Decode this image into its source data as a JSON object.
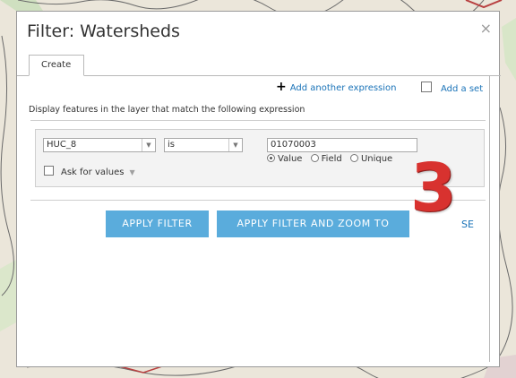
{
  "dialog": {
    "title": "Filter: Watersheds",
    "close_glyph": "×"
  },
  "tabs": [
    {
      "label": "Create",
      "active": true
    }
  ],
  "toolbar": {
    "add_expression_icon": "+",
    "add_expression_label": "Add another expression",
    "add_set_label": "Add a set"
  },
  "description": "Display features in the layer that match the following expression",
  "expression": {
    "field_value": "HUC_8",
    "operator_value": "is",
    "input_value": "01070003",
    "radio_options": [
      {
        "label": "Value",
        "selected": true
      },
      {
        "label": "Field",
        "selected": false
      },
      {
        "label": "Unique",
        "selected": false
      }
    ],
    "ask_for_values_label": "Ask for values",
    "ask_for_values_checked": false
  },
  "buttons": {
    "apply_filter": "APPLY FILTER",
    "apply_filter_zoom": "APPLY FILTER AND ZOOM TO",
    "close_partial": "SE"
  },
  "annotation": {
    "step_number": "3",
    "color": "#d8322f"
  },
  "colors": {
    "accent_button": "#5aacdc",
    "link": "#1a73b8"
  }
}
